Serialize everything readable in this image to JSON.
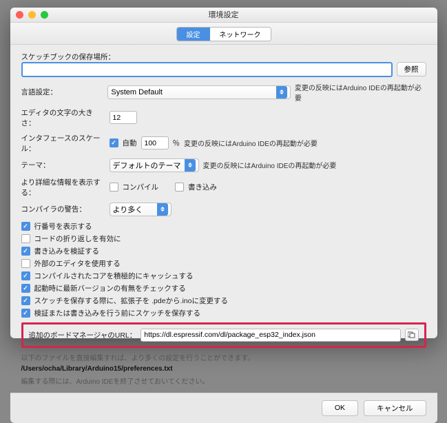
{
  "window": {
    "title": "環境設定"
  },
  "tabs": {
    "settings": "設定",
    "network": "ネットワーク"
  },
  "sketch": {
    "label": "スケッチブックの保存場所：",
    "value": "",
    "browse": "参照"
  },
  "lang": {
    "label": "言語設定：",
    "value": "System Default",
    "note": "変更の反映にはArduino IDEの再起動が必要"
  },
  "fontsize": {
    "label": "エディタの文字の大きさ：",
    "value": "12"
  },
  "scale": {
    "label": "インタフェースのスケール：",
    "auto": "自動",
    "value": "100",
    "pct": "％",
    "note": "変更の反映にはArduino IDEの再起動が必要"
  },
  "theme": {
    "label": "テーマ：",
    "value": "デフォルトのテーマ",
    "note": "変更の反映にはArduino IDEの再起動が必要"
  },
  "verbose": {
    "label": "より詳細な情報を表示する：",
    "compile": "コンパイル",
    "upload": "書き込み"
  },
  "warn": {
    "label": "コンパイラの警告：",
    "value": "より多く"
  },
  "opts": {
    "line": "行番号を表示する",
    "fold": "コードの折り返しを有効に",
    "verify": "書き込みを検証する",
    "ext": "外部のエディタを使用する",
    "cache": "コンパイルされたコアを積極的にキャッシュする",
    "update": "起動時に最新バージョンの有無をチェックする",
    "pde": "スケッチを保存する際に、拡張子を .pdeから.inoに変更する",
    "savepre": "検証または書き込みを行う前にスケッチを保存する"
  },
  "board": {
    "label": "追加のボードマネージャのURL：",
    "value": "https://dl.espressif.com/dl/package_esp32_index.json"
  },
  "belowtxt": "以下のファイルを直接編集すれば、より多くの設定を行うことができます。",
  "pref": "/Users/ocha/Library/Arduino15/preferences.txt",
  "editnote": "編集する際には、Arduino IDEを終了させておいてください。",
  "ok": "OK",
  "cancel": "キャンセル"
}
